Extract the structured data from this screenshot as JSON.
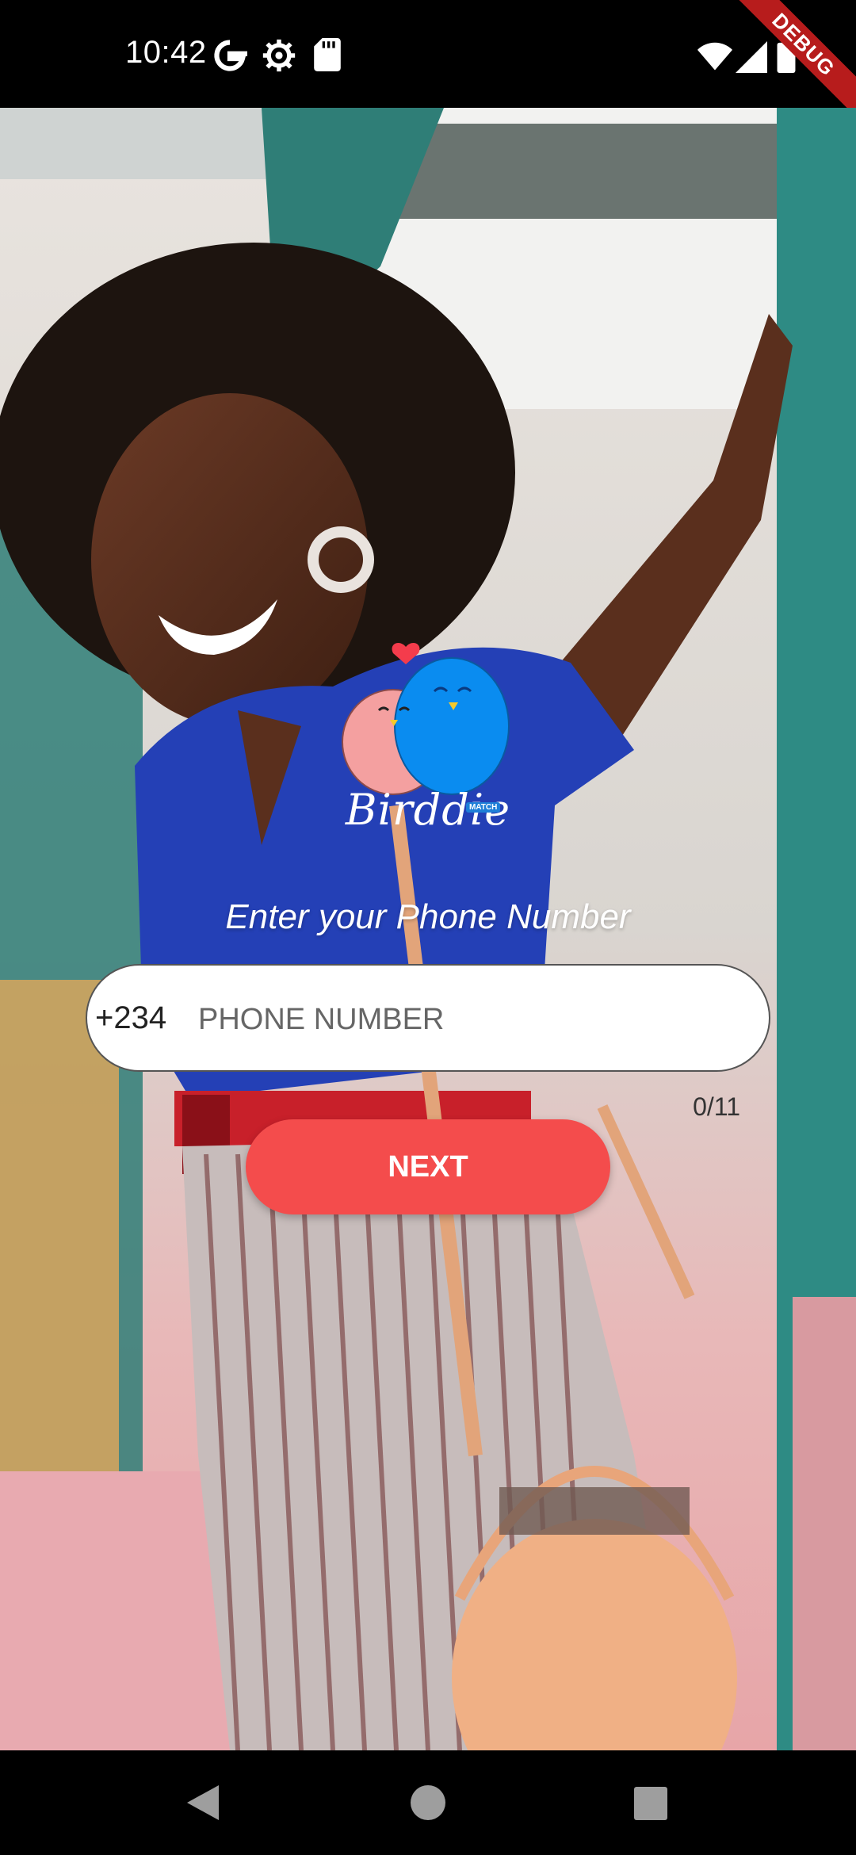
{
  "status_bar": {
    "time": "10:42",
    "icons": [
      "google-icon",
      "gear-icon",
      "sd-card-icon",
      "wifi-icon",
      "signal-icon",
      "battery-icon"
    ],
    "debug_label": "DEBUG"
  },
  "logo": {
    "name": "Birddie",
    "badge": "MATCH"
  },
  "form": {
    "prompt": "Enter your Phone Number",
    "country_code": "+234",
    "phone_placeholder": "PHONE NUMBER",
    "phone_value": "",
    "counter": "0/11",
    "next_label": "NEXT"
  },
  "colors": {
    "accent": "#f44c4c",
    "pink_bird": "#f4a0a0",
    "blue_bird": "#0a8cf0"
  },
  "nav_bar": {
    "buttons": [
      "back-icon",
      "home-icon",
      "recents-icon"
    ]
  }
}
